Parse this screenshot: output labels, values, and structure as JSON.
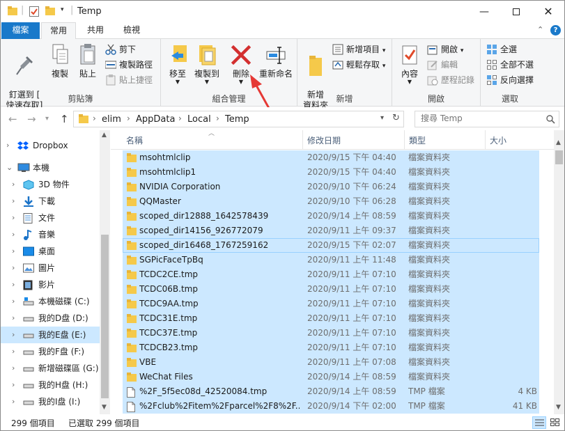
{
  "window": {
    "title": "Temp"
  },
  "tabs": {
    "file": "檔案",
    "home": "常用",
    "share": "共用",
    "view": "檢視"
  },
  "ribbon": {
    "clipboard": {
      "label": "剪貼簿",
      "pin": "釘選到 [\n快速存取]",
      "copy": "複製",
      "paste": "貼上",
      "cut": "剪下",
      "copy_path": "複製路徑",
      "paste_shortcut": "貼上捷徑"
    },
    "organize": {
      "label": "組合管理",
      "move_to": "移至",
      "copy_to": "複製到",
      "delete": "刪除",
      "rename": "重新命名"
    },
    "new": {
      "label": "新增",
      "new_folder": "新增\n資料夾",
      "new_item": "新增項目",
      "easy_access": "輕鬆存取"
    },
    "open": {
      "label": "開啟",
      "properties": "內容",
      "open": "開啟",
      "edit": "編輯",
      "history": "歷程記錄"
    },
    "select": {
      "label": "選取",
      "select_all": "全選",
      "select_none": "全部不選",
      "invert": "反向選擇"
    }
  },
  "address": {
    "crumbs": [
      "elim",
      "AppData",
      "Local",
      "Temp"
    ],
    "search_placeholder": "搜尋 Temp"
  },
  "nav": [
    {
      "label": "Dropbox",
      "icon": "dropbox-icon"
    },
    {
      "label": "本機",
      "icon": "computer-icon"
    },
    {
      "label": "3D 物件",
      "icon": "3d-objects-icon"
    },
    {
      "label": "下載",
      "icon": "download-icon"
    },
    {
      "label": "文件",
      "icon": "documents-icon"
    },
    {
      "label": "音樂",
      "icon": "music-icon"
    },
    {
      "label": "桌面",
      "icon": "desktop-icon"
    },
    {
      "label": "圖片",
      "icon": "pictures-icon"
    },
    {
      "label": "影片",
      "icon": "videos-icon"
    },
    {
      "label": "本機磁碟 (C:)",
      "icon": "system-drive-icon"
    },
    {
      "label": "我的D盘 (D:)",
      "icon": "drive-icon"
    },
    {
      "label": "我的E盘 (E:)",
      "icon": "drive-icon"
    },
    {
      "label": "我的F盘 (F:)",
      "icon": "drive-icon"
    },
    {
      "label": "新增磁碟區 (G:)",
      "icon": "drive-icon"
    },
    {
      "label": "我的H盘 (H:)",
      "icon": "drive-icon"
    },
    {
      "label": "我的I盘 (I:)",
      "icon": "drive-icon"
    }
  ],
  "columns": {
    "name": "名稱",
    "date": "修改日期",
    "type": "類型",
    "size": "大小"
  },
  "files": [
    {
      "name": "msohtmlclip",
      "date": "2020/9/15 下午 04:40",
      "type": "檔案資料夾",
      "size": "",
      "kind": "folder"
    },
    {
      "name": "msohtmlclip1",
      "date": "2020/9/15 下午 04:40",
      "type": "檔案資料夾",
      "size": "",
      "kind": "folder"
    },
    {
      "name": "NVIDIA Corporation",
      "date": "2020/9/10 下午 06:24",
      "type": "檔案資料夾",
      "size": "",
      "kind": "folder"
    },
    {
      "name": "QQMaster",
      "date": "2020/9/10 下午 06:28",
      "type": "檔案資料夾",
      "size": "",
      "kind": "folder"
    },
    {
      "name": "scoped_dir12888_1642578439",
      "date": "2020/9/14 上午 08:59",
      "type": "檔案資料夾",
      "size": "",
      "kind": "folder"
    },
    {
      "name": "scoped_dir14156_926772079",
      "date": "2020/9/11 上午 09:37",
      "type": "檔案資料夾",
      "size": "",
      "kind": "folder"
    },
    {
      "name": "scoped_dir16468_1767259162",
      "date": "2020/9/15 下午 02:07",
      "type": "檔案資料夾",
      "size": "",
      "kind": "folder"
    },
    {
      "name": "SGPicFaceTpBq",
      "date": "2020/9/11 上午 11:48",
      "type": "檔案資料夾",
      "size": "",
      "kind": "folder"
    },
    {
      "name": "TCDC2CE.tmp",
      "date": "2020/9/11 上午 07:10",
      "type": "檔案資料夾",
      "size": "",
      "kind": "folder"
    },
    {
      "name": "TCDC06B.tmp",
      "date": "2020/9/11 上午 07:10",
      "type": "檔案資料夾",
      "size": "",
      "kind": "folder"
    },
    {
      "name": "TCDC9AA.tmp",
      "date": "2020/9/11 上午 07:10",
      "type": "檔案資料夾",
      "size": "",
      "kind": "folder"
    },
    {
      "name": "TCDC31E.tmp",
      "date": "2020/9/11 上午 07:10",
      "type": "檔案資料夾",
      "size": "",
      "kind": "folder"
    },
    {
      "name": "TCDC37E.tmp",
      "date": "2020/9/11 上午 07:10",
      "type": "檔案資料夾",
      "size": "",
      "kind": "folder"
    },
    {
      "name": "TCDCB23.tmp",
      "date": "2020/9/11 上午 07:10",
      "type": "檔案資料夾",
      "size": "",
      "kind": "folder"
    },
    {
      "name": "VBE",
      "date": "2020/9/11 上午 07:08",
      "type": "檔案資料夾",
      "size": "",
      "kind": "folder"
    },
    {
      "name": "WeChat Files",
      "date": "2020/9/14 上午 08:59",
      "type": "檔案資料夾",
      "size": "",
      "kind": "folder"
    },
    {
      "name": "%2F_5f5ec08d_42520084.tmp",
      "date": "2020/9/14 上午 08:59",
      "type": "TMP 檔案",
      "size": "4 KB",
      "kind": "file"
    },
    {
      "name": "%2Fclub%2Fitem%2Fparcel%2F8%2F...",
      "date": "2020/9/14 下午 02:00",
      "type": "TMP 檔案",
      "size": "41 KB",
      "kind": "file"
    }
  ],
  "status": {
    "count": "299 個項目",
    "selected": "已選取 299 個項目"
  },
  "colors": {
    "accent": "#1979ca",
    "selection": "#cce8ff",
    "delete_red": "#d32f2f",
    "arrow_red": "#e53935"
  }
}
